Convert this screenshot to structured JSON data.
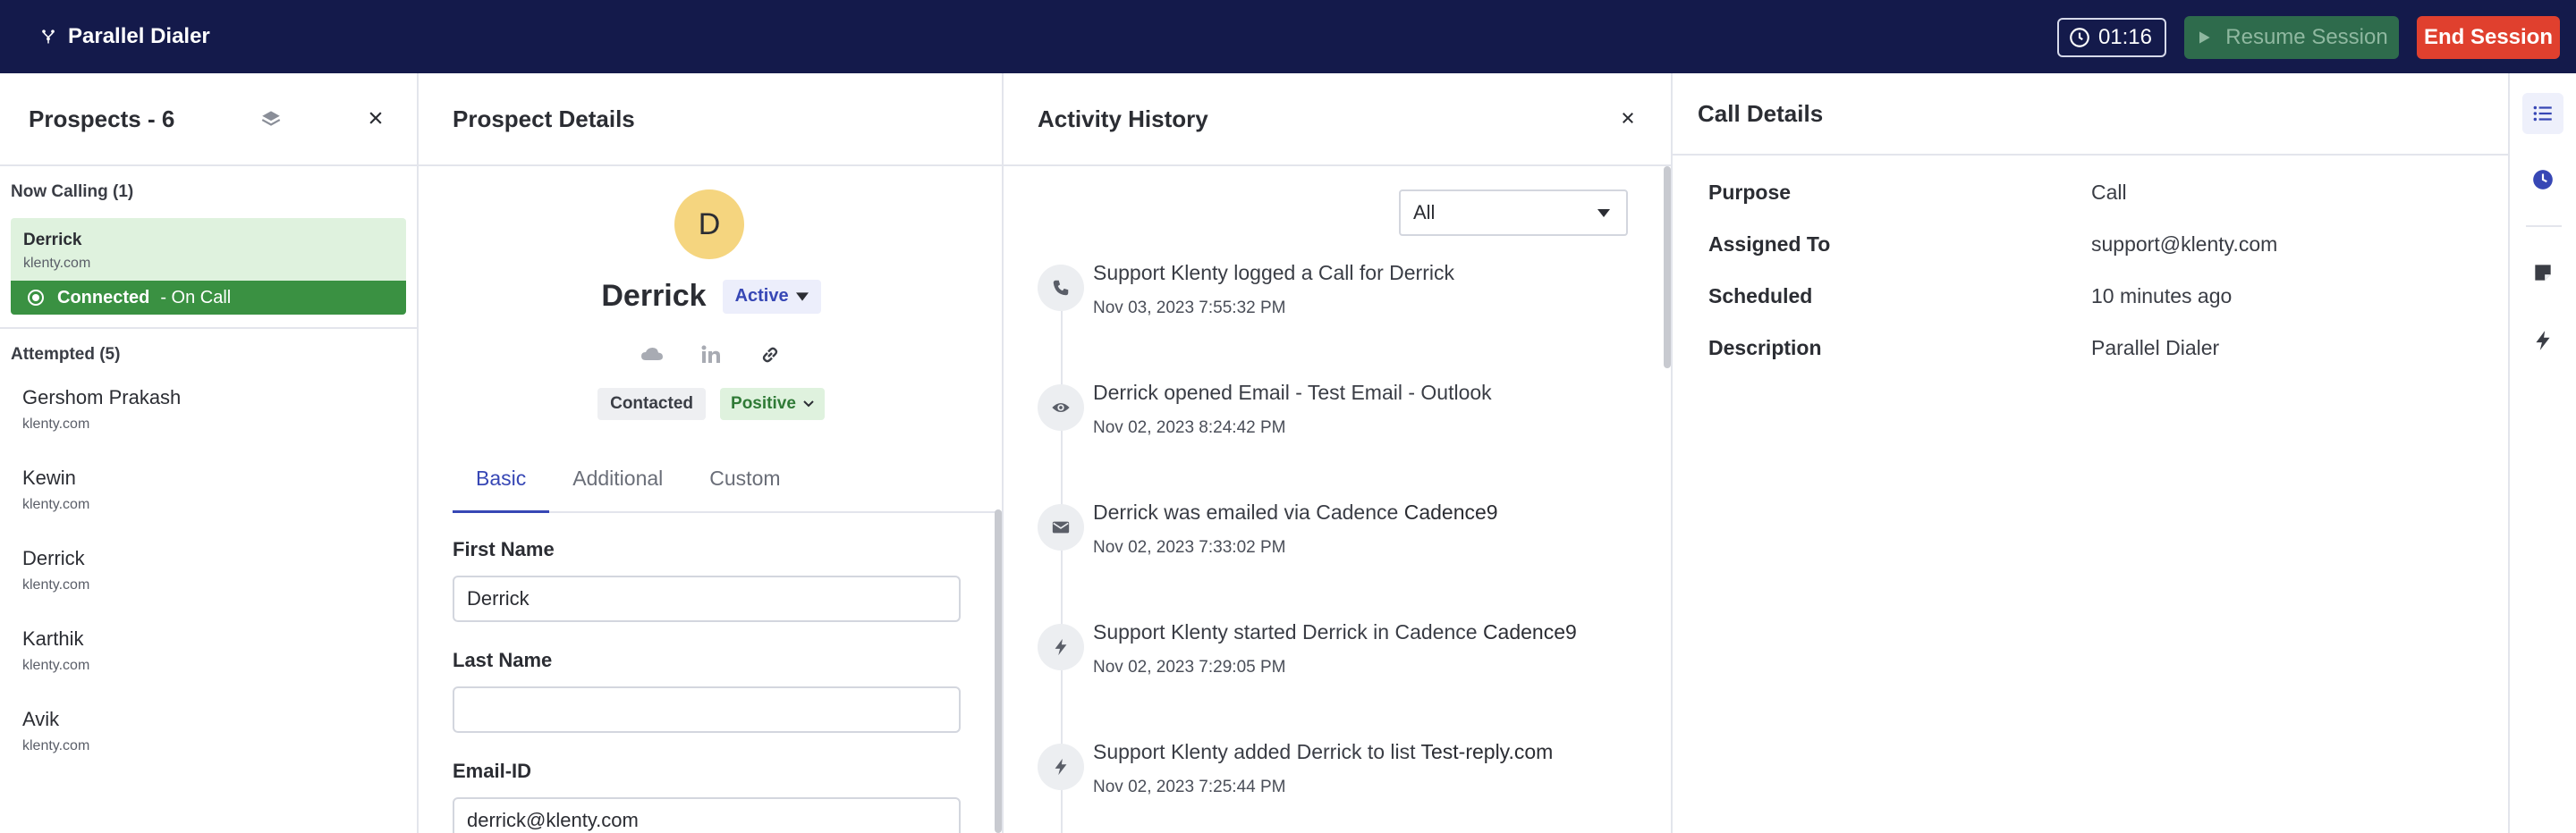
{
  "app": {
    "title": "Parallel Dialer",
    "timer": "01:16",
    "resume_label": "Resume Session",
    "end_label": "End Session"
  },
  "colors": {
    "topbar": "#141a4b",
    "accent": "#3747b5",
    "connected": "#3a9142",
    "end_button": "#e0402e",
    "resume_button": "#2e6b4c",
    "avatar": "#f5d57f"
  },
  "prospects": {
    "title": "Prospects - 6",
    "now_calling_label": "Now Calling (1)",
    "current": {
      "name": "Derrick",
      "domain": "klenty.com",
      "status": "Connected",
      "substatus": "- On Call"
    },
    "attempted_label": "Attempted (5)",
    "attempted": [
      {
        "name": "Gershom Prakash",
        "domain": "klenty.com"
      },
      {
        "name": "Kewin",
        "domain": "klenty.com"
      },
      {
        "name": "Derrick",
        "domain": "klenty.com"
      },
      {
        "name": "Karthik",
        "domain": "klenty.com"
      },
      {
        "name": "Avik",
        "domain": "klenty.com"
      }
    ]
  },
  "details": {
    "title": "Prospect Details",
    "avatar_initial": "D",
    "name": "Derrick",
    "status": "Active",
    "tags": {
      "contacted": "Contacted",
      "sentiment": "Positive"
    },
    "social_icons": [
      "cloud-icon",
      "linkedin-icon",
      "link-icon"
    ],
    "tabs": [
      "Basic",
      "Additional",
      "Custom"
    ],
    "active_tab": "Basic",
    "fields": [
      {
        "label": "First Name",
        "value": "Derrick"
      },
      {
        "label": "Last Name",
        "value": ""
      },
      {
        "label": "Email-ID",
        "value": "derrick@klenty.com"
      }
    ]
  },
  "activity": {
    "title": "Activity History",
    "filter": "All",
    "items": [
      {
        "icon": "phone-icon",
        "text": "Support Klenty logged a Call for Derrick",
        "strong": "",
        "time": "Nov 03, 2023 7:55:32 PM"
      },
      {
        "icon": "eye-icon",
        "text": "Derrick opened Email - Test Email - Outlook",
        "strong": "",
        "time": "Nov 02, 2023 8:24:42 PM"
      },
      {
        "icon": "mail-icon",
        "text": "Derrick was emailed via Cadence ",
        "strong": "Cadence9",
        "time": "Nov 02, 2023 7:33:02 PM"
      },
      {
        "icon": "bolt-icon",
        "text": "Support Klenty started Derrick in Cadence ",
        "strong": "Cadence9",
        "time": "Nov 02, 2023 7:29:05 PM"
      },
      {
        "icon": "bolt-icon",
        "text": "Support Klenty added Derrick to list ",
        "strong": "Test-reply.com",
        "time": "Nov 02, 2023 7:25:44 PM"
      }
    ]
  },
  "call_details": {
    "title": "Call Details",
    "rows": [
      {
        "key": "Purpose",
        "value": "Call"
      },
      {
        "key": "Assigned To",
        "value": "support@klenty.com"
      },
      {
        "key": "Scheduled",
        "value": "10 minutes ago"
      },
      {
        "key": "Description",
        "value": "Parallel Dialer"
      }
    ]
  },
  "rail": {
    "items": [
      "list-icon",
      "clock-icon",
      "note-icon",
      "bolt-icon"
    ]
  }
}
